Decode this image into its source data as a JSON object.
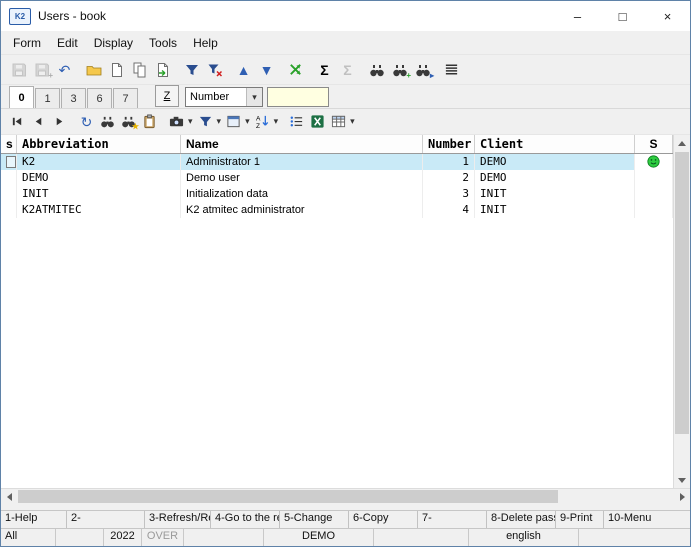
{
  "window": {
    "title": "Users - book",
    "icon_text": "K2",
    "minimize": "–",
    "maximize": "□",
    "close": "×"
  },
  "menu": {
    "items": [
      "Form",
      "Edit",
      "Display",
      "Tools",
      "Help"
    ]
  },
  "glyphs": {
    "undo": "↶",
    "sort_up": "▲",
    "sort_down": "▼",
    "sum": "Σ",
    "dropdown": "▾",
    "refresh": "↻",
    "star": "★",
    "plus": "+",
    "arrow_right_small": "▸"
  },
  "tabs": {
    "items": [
      "0",
      "1",
      "3",
      "6",
      "7"
    ],
    "z_label": "Z",
    "selector_value": "Number",
    "search_value": ""
  },
  "grid": {
    "columns": {
      "s": "s",
      "abbreviation": "Abbreviation",
      "name": "Name",
      "number": "Number",
      "client": "Client",
      "status": "S"
    },
    "rows": [
      {
        "abbreviation": "K2",
        "name": "Administrator 1",
        "number": "1",
        "client": "DEMO"
      },
      {
        "abbreviation": "DEMO",
        "name": "Demo user",
        "number": "2",
        "client": "DEMO"
      },
      {
        "abbreviation": "INIT",
        "name": "Initialization data",
        "number": "3",
        "client": "INIT"
      },
      {
        "abbreviation": "K2ATMITEC",
        "name": "K2 atmitec administrator",
        "number": "4",
        "client": "INIT"
      }
    ]
  },
  "fnbar": {
    "items": [
      "1-Help",
      "2-",
      "3-Refresh/Re",
      "4-Go to the re",
      "5-Change",
      "6-Copy",
      "7-",
      "8-Delete pass",
      "9-Print",
      "10-Menu"
    ]
  },
  "statusbar": {
    "mode": "All",
    "year": "2022",
    "overwrite": "OVER",
    "client": "DEMO",
    "language": "english"
  }
}
